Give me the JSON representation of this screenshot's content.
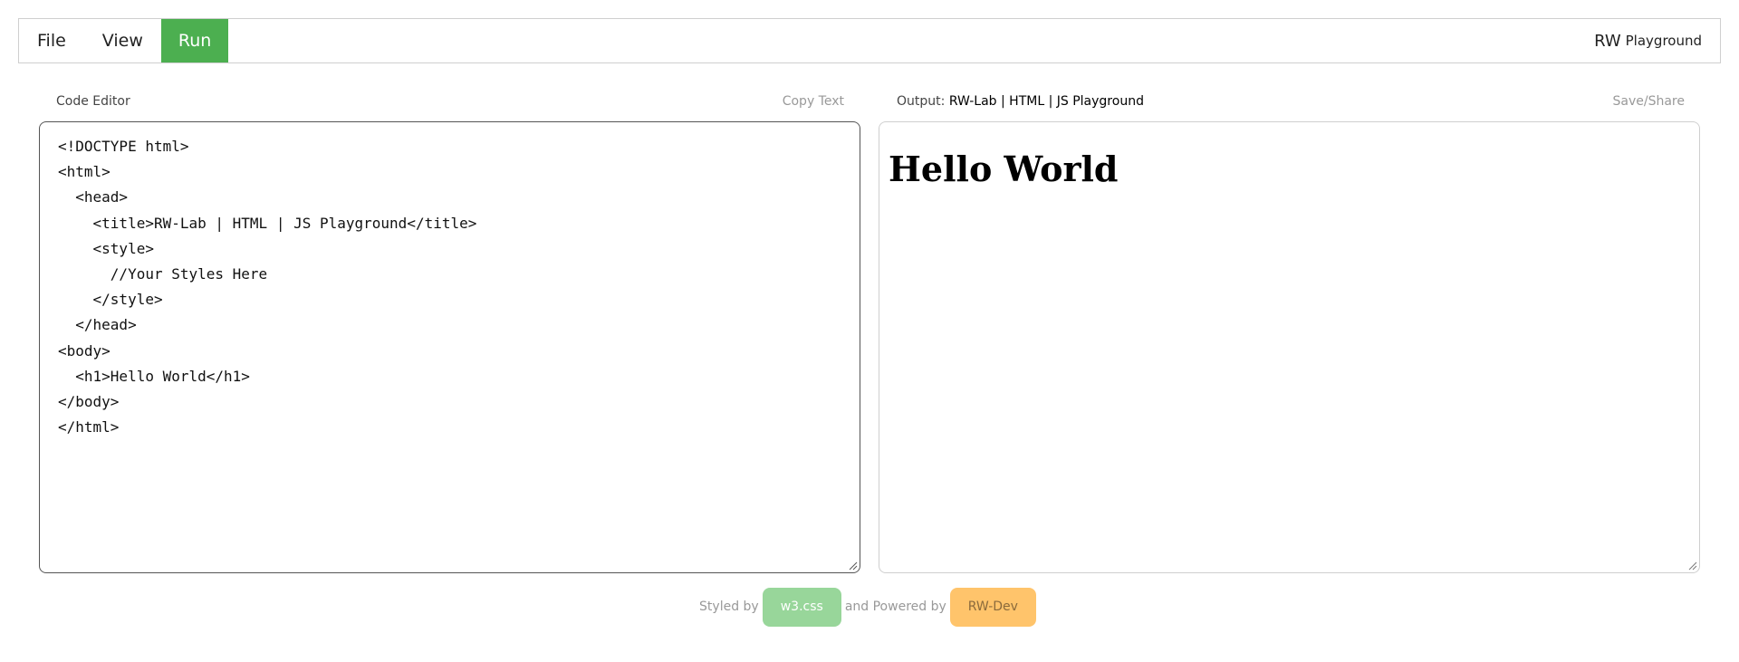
{
  "menu": {
    "file": "File",
    "view": "View",
    "run": "Run"
  },
  "brand": {
    "main": "RW",
    "sub": "Playground"
  },
  "editor_panel": {
    "title": "Code Editor",
    "copy_label": "Copy Text",
    "code": "<!DOCTYPE html>\n<html>\n  <head>\n    <title>RW-Lab | HTML | JS Playground</title>\n    <style>\n      //Your Styles Here\n    </style>\n  </head>\n<body>\n  <h1>Hello World</h1>\n</body>\n</html>"
  },
  "output_panel": {
    "label": "Output:",
    "doc_title": "RW-Lab | HTML | JS Playground",
    "save_label": "Save/Share",
    "heading": "Hello World"
  },
  "footer": {
    "styled_by": "Styled by",
    "w3css": "w3.css",
    "powered_by": "and Powered by",
    "rwdev": "RW-Dev"
  },
  "colors": {
    "run_green": "#4caf50",
    "w3css_green": "#98d69a",
    "rwdev_orange": "#ffc46b"
  }
}
